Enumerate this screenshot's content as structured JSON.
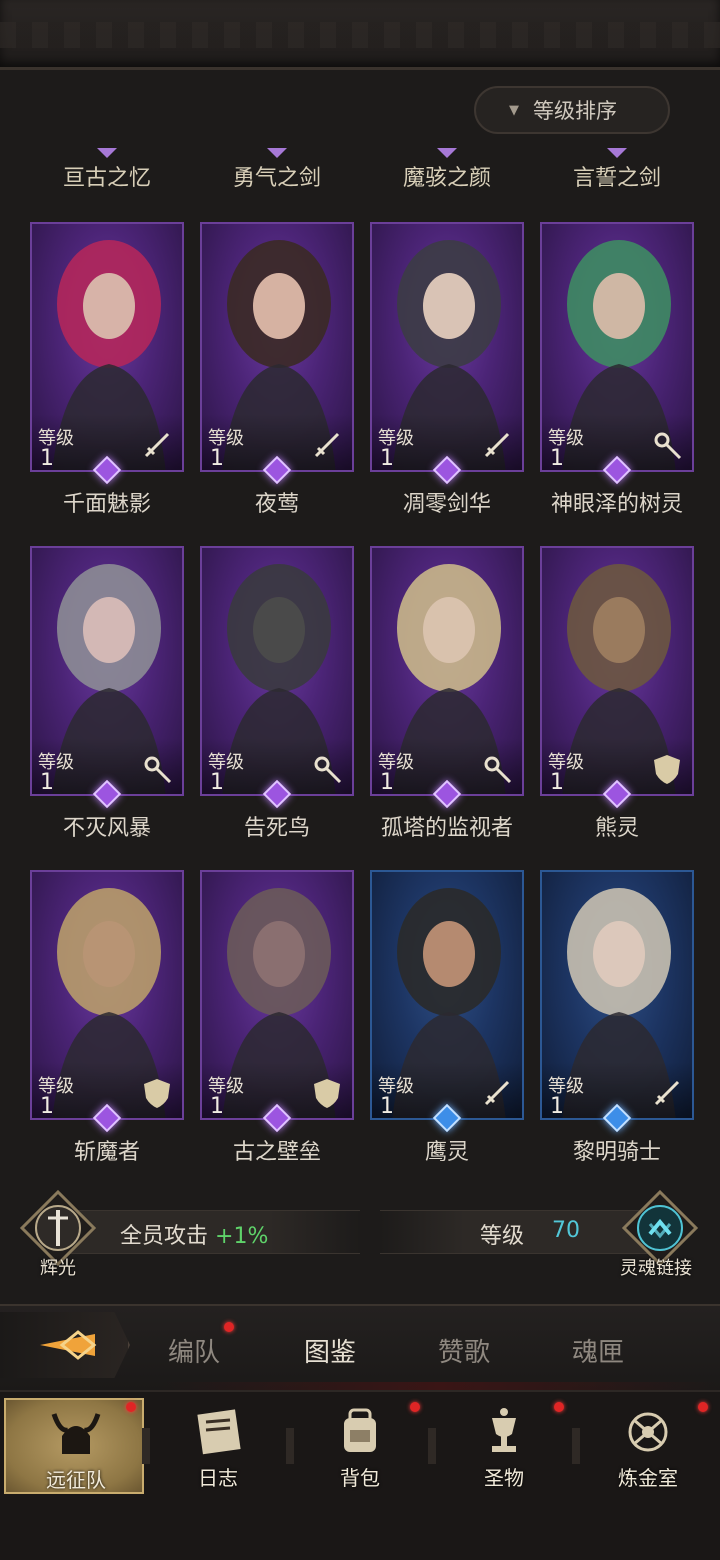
{
  "sort_button": {
    "label": "等级排序",
    "arrow_icon": "triangle-down-icon"
  },
  "groups": [
    "亘古之忆",
    "勇气之剑",
    "魔骇之颜",
    "言誓之剑"
  ],
  "heroes": [
    {
      "name": "千面魅影",
      "level_label": "等级",
      "level": "1",
      "class_icon": "sword-icon",
      "rarity": "purple"
    },
    {
      "name": "夜莺",
      "level_label": "等级",
      "level": "1",
      "class_icon": "sword-icon",
      "rarity": "purple"
    },
    {
      "name": "凋零剑华",
      "level_label": "等级",
      "level": "1",
      "class_icon": "sword-icon",
      "rarity": "purple"
    },
    {
      "name": "神眼泽的树灵",
      "level_label": "等级",
      "level": "1",
      "class_icon": "staff-icon",
      "rarity": "purple"
    },
    {
      "name": "不灭风暴",
      "level_label": "等级",
      "level": "1",
      "class_icon": "staff-icon",
      "rarity": "purple"
    },
    {
      "name": "告死鸟",
      "level_label": "等级",
      "level": "1",
      "class_icon": "staff-icon",
      "rarity": "purple"
    },
    {
      "name": "孤塔的监视者",
      "level_label": "等级",
      "level": "1",
      "class_icon": "staff-icon",
      "rarity": "purple"
    },
    {
      "name": "熊灵",
      "level_label": "等级",
      "level": "1",
      "class_icon": "shield-icon",
      "rarity": "purple"
    },
    {
      "name": "斩魔者",
      "level_label": "等级",
      "level": "1",
      "class_icon": "shield-icon",
      "rarity": "purple"
    },
    {
      "name": "古之壁垒",
      "level_label": "等级",
      "level": "1",
      "class_icon": "shield-icon",
      "rarity": "purple"
    },
    {
      "name": "鹰灵",
      "level_label": "等级",
      "level": "1",
      "class_icon": "sword-icon",
      "rarity": "blue"
    },
    {
      "name": "黎明骑士",
      "level_label": "等级",
      "level": "1",
      "class_icon": "sword-icon",
      "rarity": "blue"
    }
  ],
  "bonus": {
    "left_emblem_label": "辉光",
    "attack_text": "全员攻击",
    "attack_value": "+1%",
    "level_label": "等级",
    "level_value": "70",
    "right_emblem_label": "灵魂链接"
  },
  "tabs": [
    {
      "label": "编队",
      "badge": true
    },
    {
      "label": "图鉴",
      "active": true
    },
    {
      "label": "赞歌"
    },
    {
      "label": "魂匣"
    }
  ],
  "bottom_nav": [
    {
      "label": "远征队",
      "icon": "horned-helmet-icon",
      "active": true,
      "badge": true
    },
    {
      "label": "日志",
      "icon": "scroll-icon"
    },
    {
      "label": "背包",
      "icon": "backpack-icon",
      "badge": true
    },
    {
      "label": "圣物",
      "icon": "chalice-icon",
      "badge": true
    },
    {
      "label": "炼金室",
      "icon": "alchemy-icon",
      "badge": true
    }
  ],
  "colors": {
    "purple_card": "#4b2476",
    "blue_card": "#1d3563",
    "bonus_green": "#5fd36a",
    "level_cyan": "#52c7d8",
    "badge_red": "#e02525"
  }
}
